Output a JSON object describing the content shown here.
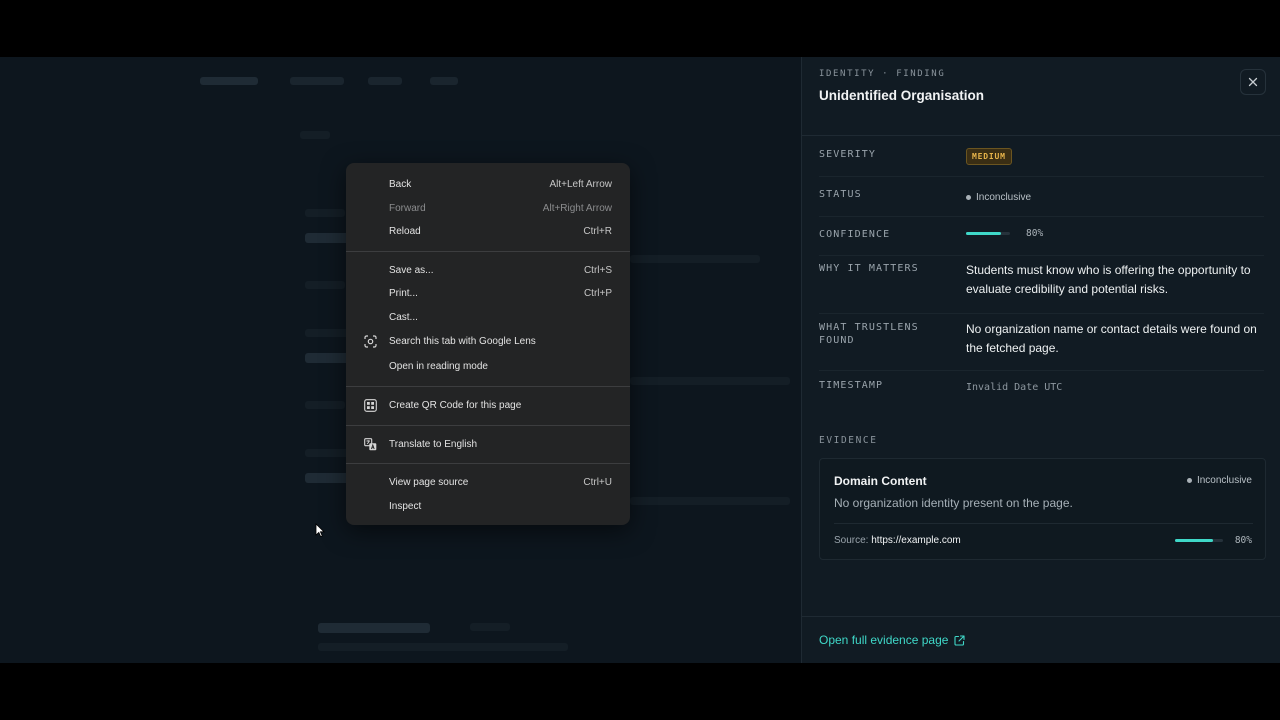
{
  "context_menu": {
    "items": [
      {
        "label": "Back",
        "shortcut": "Alt+Left Arrow"
      },
      {
        "label": "Forward",
        "shortcut": "Alt+Right Arrow"
      },
      {
        "label": "Reload",
        "shortcut": "Ctrl+R"
      },
      {
        "label": "Save as...",
        "shortcut": "Ctrl+S"
      },
      {
        "label": "Print...",
        "shortcut": "Ctrl+P"
      },
      {
        "label": "Cast..."
      },
      {
        "label": "Search this tab with Google Lens",
        "icon": "google-lens-icon"
      },
      {
        "label": "Open in reading mode"
      },
      {
        "label": "Create QR Code for this page",
        "icon": "qr-code-icon"
      },
      {
        "label": "Translate to English",
        "icon": "translate-icon"
      },
      {
        "label": "View page source",
        "shortcut": "Ctrl+U"
      },
      {
        "label": "Inspect"
      }
    ]
  },
  "panel": {
    "eyebrow": "IDENTITY · FINDING",
    "title": "Unidentified Organisation",
    "severity": {
      "label": "SEVERITY",
      "value": "MEDIUM"
    },
    "status": {
      "label": "STATUS",
      "value": "Inconclusive"
    },
    "confidence": {
      "label": "CONFIDENCE",
      "value": "80%",
      "fraction": 0.8
    },
    "why": {
      "label": "WHY IT MATTERS",
      "value": "Students must know who is offering the opportunity to evaluate credibility and potential risks."
    },
    "found": {
      "label": "WHAT TRUSTLENS FOUND",
      "value": "No organization name or contact details were found on the fetched page."
    },
    "timestamp": {
      "label": "TIMESTAMP",
      "value": "Invalid Date UTC"
    },
    "evidence": {
      "label": "EVIDENCE",
      "card": {
        "title": "Domain Content",
        "status": "Inconclusive",
        "description": "No organization identity present on the page.",
        "source_label": "Source:",
        "source_url": "https://example.com",
        "confidence": "80%",
        "fraction": 0.8
      }
    },
    "open_link": "Open full evidence page"
  },
  "colors": {
    "accent": "#3fd8c8",
    "severity_medium": "#e6b34a",
    "panel_bg": "#111b23",
    "menu_bg": "#232425"
  }
}
